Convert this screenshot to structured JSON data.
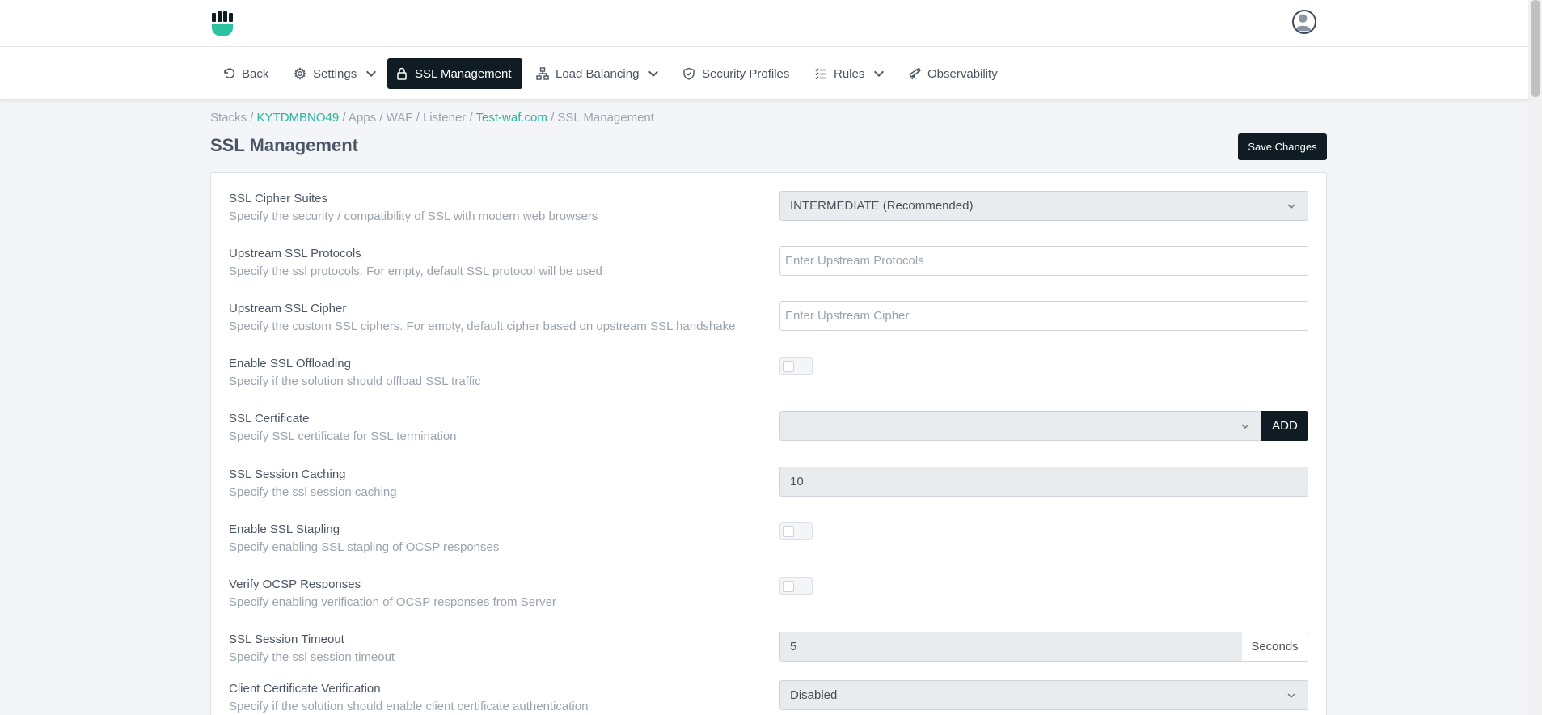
{
  "nav": {
    "back": "Back",
    "settings": "Settings",
    "ssl": "SSL Management",
    "load_balancing": "Load Balancing",
    "security_profiles": "Security Profiles",
    "rules": "Rules",
    "observability": "Observability"
  },
  "breadcrumb": {
    "stacks": "Stacks",
    "stack_id": "KYTDMBNO49",
    "apps": "Apps",
    "waf": "WAF",
    "listener": "Listener",
    "listener_name": "Test-waf.com",
    "current": "SSL Management",
    "sep": " / "
  },
  "page": {
    "title": "SSL Management",
    "save_label": "Save Changes"
  },
  "fields": {
    "cipher_suites": {
      "label": "SSL Cipher Suites",
      "desc": "Specify the security / compatibility of SSL with modern web browsers",
      "value": "INTERMEDIATE (Recommended)"
    },
    "upstream_protocols": {
      "label": "Upstream SSL Protocols",
      "desc": "Specify the ssl protocols. For empty, default SSL protocol will be used",
      "placeholder": "Enter Upstream Protocols"
    },
    "upstream_cipher": {
      "label": "Upstream SSL Cipher",
      "desc": "Specify the custom SSL ciphers. For empty, default cipher based on upstream SSL handshake",
      "placeholder": "Enter Upstream Cipher"
    },
    "ssl_offloading": {
      "label": "Enable SSL Offloading",
      "desc": "Specify if the solution should offload SSL traffic"
    },
    "ssl_certificate": {
      "label": "SSL Certificate",
      "desc": "Specify SSL certificate for SSL termination",
      "value": "",
      "add_label": "ADD"
    },
    "session_caching": {
      "label": "SSL Session Caching",
      "desc": "Specify the ssl session caching",
      "value": "10"
    },
    "ssl_stapling": {
      "label": "Enable SSL Stapling",
      "desc": "Specify enabling SSL stapling of OCSP responses"
    },
    "verify_ocsp": {
      "label": "Verify OCSP Responses",
      "desc": "Specify enabling verification of OCSP responses from Server"
    },
    "session_timeout": {
      "label": "SSL Session Timeout",
      "desc": "Specify the ssl session timeout",
      "value": "5",
      "unit": "Seconds"
    },
    "client_cert": {
      "label": "Client Certificate Verification",
      "desc": "Specify if the solution should enable client certificate authentication",
      "value": "Disabled"
    }
  },
  "colors": {
    "accent": "#2bb59a",
    "dark": "#0f1c24"
  }
}
